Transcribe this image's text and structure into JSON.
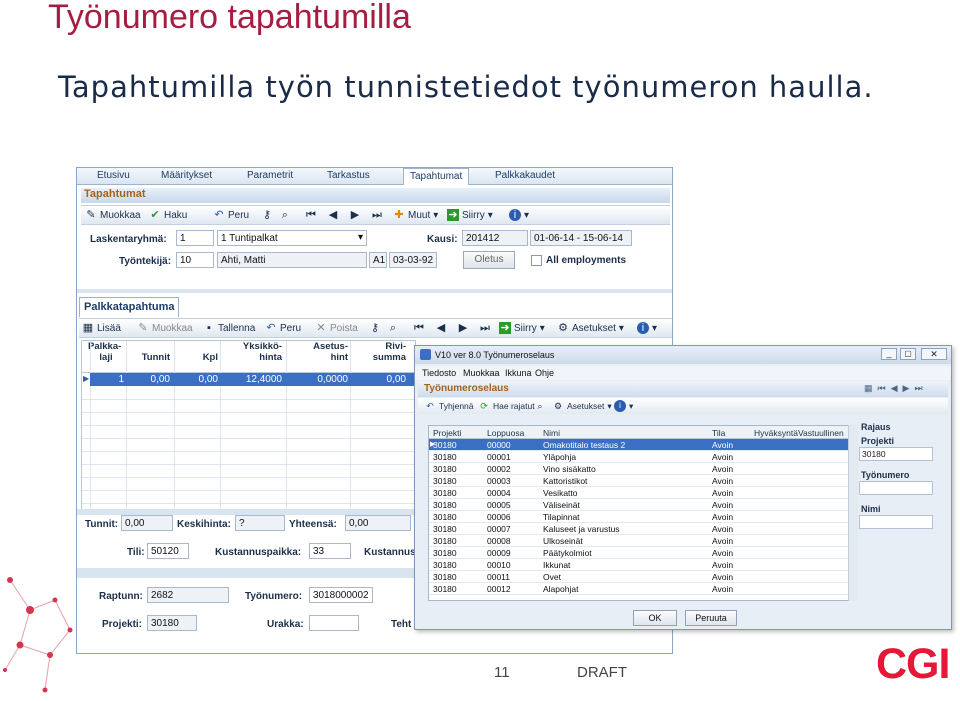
{
  "slide": {
    "title": "Työnumero tapahtumilla",
    "subtitle": "Tapahtumilla työn tunnistetiedot työnumeron haulla.",
    "page_number": "11",
    "draft": "DRAFT",
    "logo": "CGI"
  },
  "colors": {
    "title": "#a51d41",
    "accent": "#3b6fc4",
    "logo": "#e31937",
    "panel_header": "#a3621a"
  },
  "app": {
    "tabs": [
      "Etusivu",
      "Määritykset",
      "Parametrit",
      "Tarkastus",
      "Tapahtumat",
      "Palkkakaudet"
    ],
    "active_tab": "Tapahtumat",
    "panel_title": "Tapahtumat",
    "toolbar": {
      "muokkaa": "Muokkaa",
      "haku": "Haku",
      "peru": "Peru",
      "muut": "Muut",
      "siirry": "Siirry"
    },
    "laskentaryhma_label": "Laskentaryhmä:",
    "laskentaryhma_code": "1",
    "laskentaryhma_value": "1 Tuntipalkat",
    "kausi_label": "Kausi:",
    "kausi_code": "201412",
    "kausi_range": "01-06-14 - 15-06-14",
    "tyontekija_label": "Työntekijä:",
    "tyontekija_code": "10",
    "tyontekija_name": "Ahti, Matti",
    "tyontekija_a": "A1",
    "tyontekija_date": "03-03-92",
    "oletus_button": "Oletus",
    "all_employments": "All employments",
    "sub_tab": "Palkkatapahtuma",
    "toolbar2": {
      "lisaa": "Lisää",
      "muokkaa": "Muokkaa",
      "tallenna": "Tallenna",
      "peru": "Peru",
      "poista": "Poista",
      "siirry": "Siirry",
      "asetukset": "Asetukset"
    },
    "grid": {
      "headers": [
        {
          "l1": "Palkka-",
          "l2": "laji"
        },
        {
          "l1": "",
          "l2": "Tunnit"
        },
        {
          "l1": "",
          "l2": "Kpl"
        },
        {
          "l1": "Yksikkö-",
          "l2": "hinta"
        },
        {
          "l1": "Asetus-",
          "l2": "hint"
        },
        {
          "l1": "Rivi-",
          "l2": "summa"
        }
      ],
      "row": [
        "1",
        "0,00",
        "0,00",
        "12,4000",
        "0,0000",
        "0,00"
      ]
    },
    "tunnit_label": "Tunnit:",
    "tunnit_value": "0,00",
    "keskihinta_label": "Keskihinta:",
    "keskihinta_value": "?",
    "yhteensa_label": "Yhteensä:",
    "yhteensa_value": "0,00",
    "tili_label": "Tili:",
    "tili_value": "50120",
    "kustannuspaikka_label": "Kustannuspaikka:",
    "kustannuspaikka_value": "33",
    "kustannus_label": "Kustannus",
    "raptunn_label": "Raptunn:",
    "raptunn_value": "2682",
    "tyonumero_label": "Työnumero:",
    "tyonumero_value": "3018000002",
    "projekti_label": "Projekti:",
    "projekti_value": "30180",
    "urakka_label": "Urakka:",
    "tehta_label": "Teht"
  },
  "dialog": {
    "title": "V10 ver 8.0 Työnumeroselaus",
    "menu": [
      "Tiedosto",
      "Muokkaa",
      "Ikkuna",
      "Ohje"
    ],
    "header": "Työnumeroselaus",
    "toolbar": {
      "tyhjenna": "Tyhjennä",
      "hae_rajatut": "Hae rajatut",
      "asetukset": "Asetukset"
    },
    "columns": [
      "Projekti",
      "Loppuosa",
      "Nimi",
      "Tila",
      "Hyväksyntä",
      "Vastuullinen"
    ],
    "rows": [
      [
        "30180",
        "00000",
        "Omakotitalo testaus 2",
        "Avoin"
      ],
      [
        "30180",
        "00001",
        "Yläpohja",
        "Avoin"
      ],
      [
        "30180",
        "00002",
        "Vino sisäkatto",
        "Avoin"
      ],
      [
        "30180",
        "00003",
        "Kattoristikot",
        "Avoin"
      ],
      [
        "30180",
        "00004",
        "Vesikatto",
        "Avoin"
      ],
      [
        "30180",
        "00005",
        "Väliseinät",
        "Avoin"
      ],
      [
        "30180",
        "00006",
        "Tilapinnat",
        "Avoin"
      ],
      [
        "30180",
        "00007",
        "Kaluseet ja varustus",
        "Avoin"
      ],
      [
        "30180",
        "00008",
        "Ulkoseinät",
        "Avoin"
      ],
      [
        "30180",
        "00009",
        "Päätykolmiot",
        "Avoin"
      ],
      [
        "30180",
        "00010",
        "Ikkunat",
        "Avoin"
      ],
      [
        "30180",
        "00011",
        "Ovet",
        "Avoin"
      ],
      [
        "30180",
        "00012",
        "Alapohjat",
        "Avoin"
      ]
    ],
    "rajaus": "Rajaus",
    "projekti_label": "Projekti",
    "projekti_value": "30180",
    "tyonumero_label": "Työnumero",
    "nimi_label": "Nimi",
    "ok": "OK",
    "peruuta": "Peruuta"
  }
}
